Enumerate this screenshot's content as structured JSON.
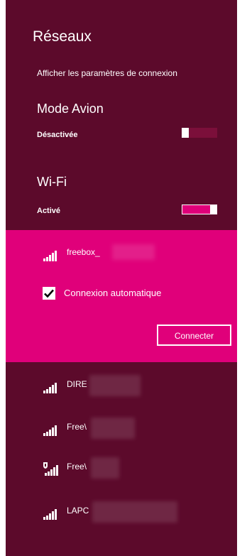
{
  "panel": {
    "title": "Réseaux",
    "settings_link": "Afficher les paramètres de connexion"
  },
  "airplane": {
    "heading": "Mode Avion",
    "state_label": "Désactivée",
    "enabled": false
  },
  "wifi": {
    "heading": "Wi-Fi",
    "state_label": "Activé",
    "enabled": true
  },
  "selected_network": {
    "name": "freebox_",
    "icon": "wifi-signal-icon",
    "auto_connect_label": "Connexion automatique",
    "auto_connect_checked": true,
    "connect_label": "Connecter"
  },
  "networks": [
    {
      "name": "DIRE",
      "icon": "wifi-signal-icon",
      "secured_shield": false
    },
    {
      "name": "Free\\",
      "icon": "wifi-signal-icon",
      "secured_shield": false
    },
    {
      "name": "Free\\",
      "icon": "wifi-shield-signal-icon",
      "secured_shield": true
    },
    {
      "name": "LAPC",
      "icon": "wifi-signal-icon",
      "secured_shield": false
    }
  ],
  "colors": {
    "panel_bg": "#5c0a2b",
    "accent": "#e0007a",
    "text": "#ffffff"
  }
}
